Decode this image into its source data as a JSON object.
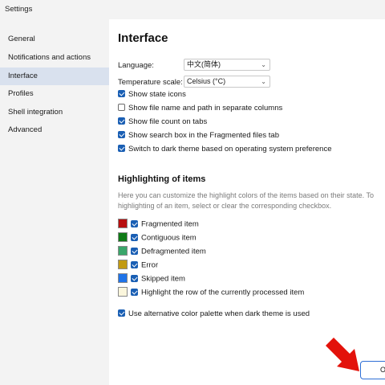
{
  "window": {
    "title": "Settings"
  },
  "sidebar": {
    "items": [
      {
        "label": "General"
      },
      {
        "label": "Notifications and actions"
      },
      {
        "label": "Interface",
        "active": true
      },
      {
        "label": "Profiles"
      },
      {
        "label": "Shell integration"
      },
      {
        "label": "Advanced"
      }
    ]
  },
  "main": {
    "title": "Interface",
    "language": {
      "label": "Language:",
      "value": "中文(简体)"
    },
    "temperature": {
      "label": "Temperature scale:",
      "value": "Celsius (°C)"
    },
    "options": [
      {
        "label": "Show state icons",
        "checked": true
      },
      {
        "label": "Show file name and path in separate columns",
        "checked": false
      },
      {
        "label": "Show file count on tabs",
        "checked": true
      },
      {
        "label": "Show search box in the Fragmented files tab",
        "checked": true
      },
      {
        "label": "Switch to dark theme based on operating system preference",
        "checked": true
      }
    ],
    "highlighting": {
      "title": "Highlighting of items",
      "description_line1": "Here you can customize the highlight colors of the items based on their state. To",
      "description_line2": "highlighting of an item, select or clear the corresponding checkbox.",
      "items": [
        {
          "label": "Fragmented item",
          "color": "#b80f0f",
          "checked": true
        },
        {
          "label": "Contiguous item",
          "color": "#0f7a16",
          "checked": true
        },
        {
          "label": "Defragmented item",
          "color": "#3aa66a",
          "checked": true
        },
        {
          "label": "Error",
          "color": "#c29a12",
          "checked": true
        },
        {
          "label": "Skipped item",
          "color": "#1f73e8",
          "checked": true
        },
        {
          "label": "Highlight the row of the currently processed item",
          "color": "#fbf6dc",
          "checked": true
        }
      ],
      "alt_palette": {
        "label": "Use alternative color palette when dark theme is used",
        "checked": true
      }
    }
  },
  "footer": {
    "ok_label": "O"
  },
  "colors": {
    "accent": "#1a5fb4",
    "arrow": "#e3120b",
    "sidebar_active": "#d9e1ee"
  }
}
